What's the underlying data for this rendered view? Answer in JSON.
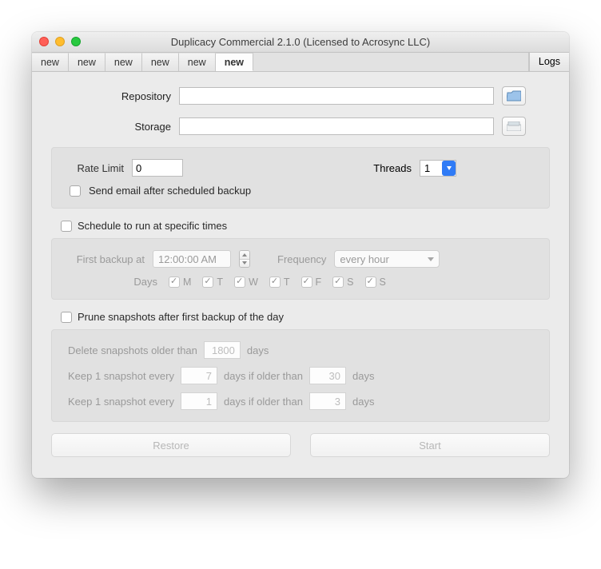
{
  "window": {
    "title": "Duplicacy Commercial 2.1.0 (Licensed to Acrosync LLC)"
  },
  "tabs": {
    "items": [
      "new",
      "new",
      "new",
      "new",
      "new",
      "new"
    ],
    "activeIndex": 5,
    "logs": "Logs"
  },
  "fields": {
    "repository_label": "Repository",
    "repository_value": "",
    "storage_label": "Storage",
    "storage_value": ""
  },
  "limits": {
    "rate_label": "Rate Limit",
    "rate_value": "0",
    "threads_label": "Threads",
    "threads_value": "1",
    "email_label": "Send email after scheduled backup"
  },
  "schedule": {
    "enable_label": "Schedule to run at specific times",
    "first_label": "First backup at",
    "first_value": "12:00:00 AM",
    "freq_label": "Frequency",
    "freq_value": "every hour",
    "days_label": "Days",
    "days": [
      "M",
      "T",
      "W",
      "T",
      "F",
      "S",
      "S"
    ]
  },
  "prune": {
    "enable_label": "Prune snapshots after first backup of the day",
    "l1a": "Delete snapshots older than",
    "v1": "1800",
    "l1b": "days",
    "l2a": "Keep 1 snapshot every",
    "v2": "7",
    "l2b": "days if older than",
    "v3": "30",
    "l2c": "days",
    "l3a": "Keep 1 snapshot every",
    "v4": "1",
    "l3b": "days if older than",
    "v5": "3",
    "l3c": "days"
  },
  "buttons": {
    "restore": "Restore",
    "start": "Start"
  }
}
